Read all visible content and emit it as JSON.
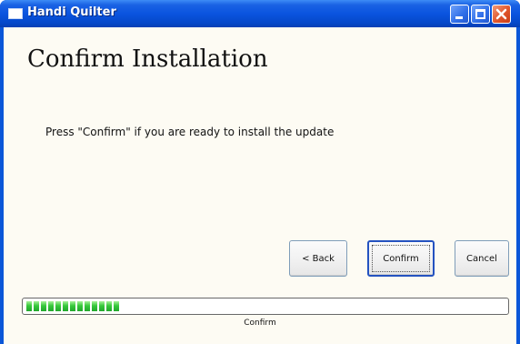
{
  "window": {
    "title": "Handi Quilter",
    "titlebar_color": "#0a54df"
  },
  "page": {
    "heading": "Confirm Installation",
    "message": "Press \"Confirm\" if you are ready to install the update"
  },
  "buttons": {
    "back_label": "< Back",
    "confirm_label": "Confirm",
    "cancel_label": "Cancel"
  },
  "progress": {
    "fraction": 0.2,
    "label": "Confirm",
    "color": "#36c83b"
  }
}
